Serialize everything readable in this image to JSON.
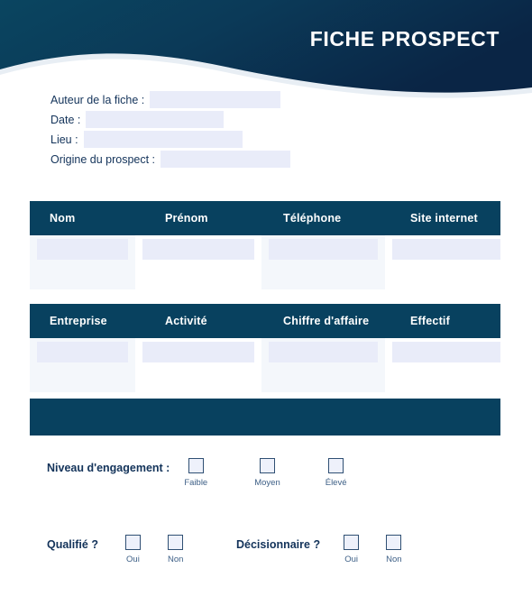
{
  "document": {
    "title": "FICHE PROSPECT"
  },
  "colors": {
    "header_dark": "#08415f",
    "header_deep": "#0a2a4d",
    "wave_light": "#e8eef4",
    "input_fill": "#e9ecf9",
    "stripe": "#f4f7fb",
    "text_navy": "#13335a",
    "label_blue": "#3d5f86",
    "checkbox_border": "#2f4f73"
  },
  "meta_fields": [
    {
      "label": "Auteur de la fiche :",
      "value": "",
      "placeholder": ""
    },
    {
      "label": "Date :",
      "value": "",
      "placeholder": ""
    },
    {
      "label": "Lieu :",
      "value": "",
      "placeholder": ""
    },
    {
      "label": "Origine du prospect :",
      "value": "",
      "placeholder": ""
    }
  ],
  "contact_table": {
    "headers": [
      "Nom",
      "Prénom",
      "Téléphone",
      "Site internet"
    ],
    "rows": [
      [
        "",
        "",
        "",
        ""
      ]
    ]
  },
  "company_table": {
    "headers": [
      "Entreprise",
      "Activité",
      "Chiffre d'affaire",
      "Effectif"
    ],
    "rows": [
      [
        "",
        "",
        "",
        ""
      ]
    ]
  },
  "engagement": {
    "title": "Niveau d'engagement :",
    "options": [
      {
        "label": "Faible",
        "checked": false
      },
      {
        "label": "Moyen",
        "checked": false
      },
      {
        "label": "Élevé",
        "checked": false
      }
    ]
  },
  "qualifie": {
    "title": "Qualifié ?",
    "options": [
      {
        "label": "Oui",
        "checked": false
      },
      {
        "label": "Non",
        "checked": false
      }
    ]
  },
  "decisionnaire": {
    "title": "Décisionnaire ?",
    "options": [
      {
        "label": "Oui",
        "checked": false
      },
      {
        "label": "Non",
        "checked": false
      }
    ]
  }
}
